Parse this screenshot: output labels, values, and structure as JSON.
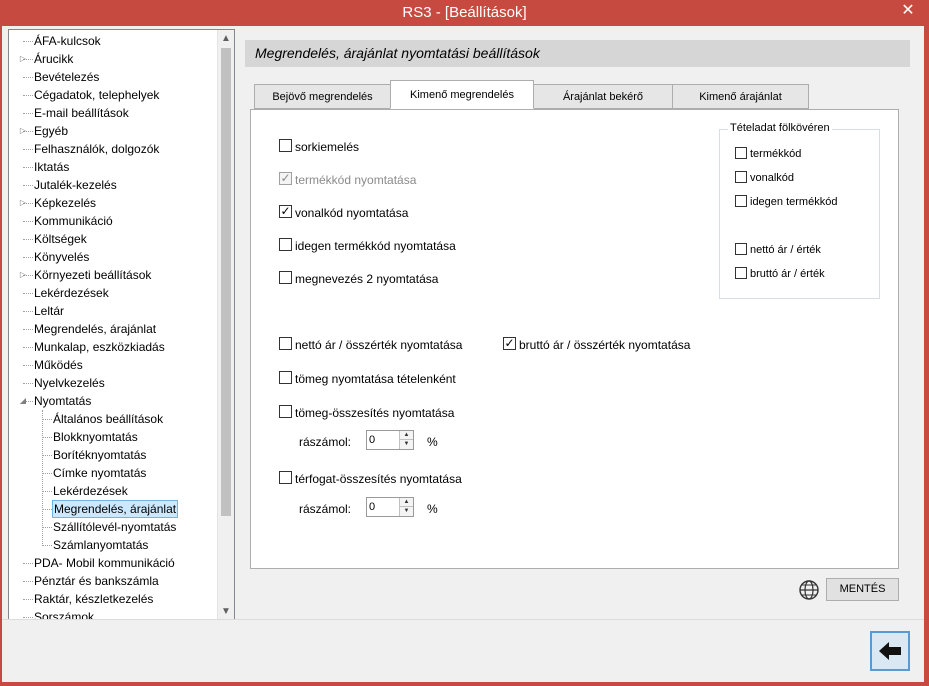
{
  "window": {
    "title": "RS3 - [Beállítások]",
    "close_label": "✕"
  },
  "tree": {
    "items": [
      {
        "label": "ÁFA-kulcsok",
        "level": 0,
        "expandable": false
      },
      {
        "label": "Árucikk",
        "level": 0,
        "expandable": true
      },
      {
        "label": "Bevételezés",
        "level": 0,
        "expandable": false
      },
      {
        "label": "Cégadatok, telephelyek",
        "level": 0,
        "expandable": false
      },
      {
        "label": "E-mail beállítások",
        "level": 0,
        "expandable": false
      },
      {
        "label": "Egyéb",
        "level": 0,
        "expandable": true
      },
      {
        "label": "Felhasználók, dolgozók",
        "level": 0,
        "expandable": false
      },
      {
        "label": "Iktatás",
        "level": 0,
        "expandable": false
      },
      {
        "label": "Jutalék-kezelés",
        "level": 0,
        "expandable": false
      },
      {
        "label": "Képkezelés",
        "level": 0,
        "expandable": true
      },
      {
        "label": "Kommunikáció",
        "level": 0,
        "expandable": false
      },
      {
        "label": "Költségek",
        "level": 0,
        "expandable": false
      },
      {
        "label": "Könyvelés",
        "level": 0,
        "expandable": false
      },
      {
        "label": "Környezeti beállítások",
        "level": 0,
        "expandable": true
      },
      {
        "label": "Lekérdezések",
        "level": 0,
        "expandable": false
      },
      {
        "label": "Leltár",
        "level": 0,
        "expandable": false
      },
      {
        "label": "Megrendelés, árajánlat",
        "level": 0,
        "expandable": false
      },
      {
        "label": "Munkalap, eszközkiadás",
        "level": 0,
        "expandable": false
      },
      {
        "label": "Működés",
        "level": 0,
        "expandable": false
      },
      {
        "label": "Nyelvkezelés",
        "level": 0,
        "expandable": false
      },
      {
        "label": "Nyomtatás",
        "level": 0,
        "expandable": true,
        "expanded": true
      },
      {
        "label": "Általános beállítások",
        "level": 1,
        "expandable": false
      },
      {
        "label": "Blokknyomtatás",
        "level": 1,
        "expandable": false
      },
      {
        "label": "Borítéknyomtatás",
        "level": 1,
        "expandable": false
      },
      {
        "label": "Címke nyomtatás",
        "level": 1,
        "expandable": false
      },
      {
        "label": "Lekérdezések",
        "level": 1,
        "expandable": false
      },
      {
        "label": "Megrendelés, árajánlat",
        "level": 1,
        "expandable": false,
        "selected": true
      },
      {
        "label": "Szállítólevél-nyomtatás",
        "level": 1,
        "expandable": false
      },
      {
        "label": "Számlanyomtatás",
        "level": 1,
        "expandable": false
      },
      {
        "label": "PDA- Mobil kommunikáció",
        "level": 0,
        "expandable": false
      },
      {
        "label": "Pénztár és bankszámla",
        "level": 0,
        "expandable": false
      },
      {
        "label": "Raktár, készletkezelés",
        "level": 0,
        "expandable": false
      },
      {
        "label": "Sorszámok",
        "level": 0,
        "expandable": false
      }
    ]
  },
  "section": {
    "title": "Megrendelés, árajánlat nyomtatási beállítások"
  },
  "tabs": [
    {
      "label": "Bejövő megrendelés",
      "active": false
    },
    {
      "label": "Kimenő megrendelés",
      "active": true
    },
    {
      "label": "Árajánlat bekérő",
      "active": false
    },
    {
      "label": "Kimenő árajánlat",
      "active": false
    }
  ],
  "options": {
    "sorkiemeles": {
      "label": "sorkiemelés",
      "checked": false,
      "disabled": false
    },
    "termekkod": {
      "label": "termékkód nyomtatása",
      "checked": true,
      "disabled": true
    },
    "vonalkod": {
      "label": "vonalkód nyomtatása",
      "checked": true,
      "disabled": false
    },
    "idegen": {
      "label": "idegen termékkód nyomtatása",
      "checked": false,
      "disabled": false
    },
    "megnevezes2": {
      "label": "megnevezés 2 nyomtatása",
      "checked": false,
      "disabled": false
    },
    "netto": {
      "label": "nettó ár / összérték nyomtatása",
      "checked": false,
      "disabled": false
    },
    "brutto": {
      "label": "bruttó ár / összérték nyomtatása",
      "checked": true,
      "disabled": false
    },
    "tomeg_tetel": {
      "label": "tömeg nyomtatása tételenként",
      "checked": false,
      "disabled": false
    },
    "tomeg_ossz": {
      "label": "tömeg-összesítés nyomtatása",
      "checked": false,
      "disabled": false
    },
    "terfogat_ossz": {
      "label": "térfogat-összesítés nyomtatása",
      "checked": false,
      "disabled": false
    }
  },
  "group": {
    "title": "Tételadat fölkövéren",
    "items": {
      "termekkod": {
        "label": "termékkód",
        "checked": false
      },
      "vonalkod": {
        "label": "vonalkód",
        "checked": false
      },
      "idegen": {
        "label": "idegen termékkód",
        "checked": false
      },
      "netto": {
        "label": "nettó ár / érték",
        "checked": false
      },
      "brutto": {
        "label": "bruttó ár / érték",
        "checked": false
      }
    }
  },
  "spinners": {
    "tomeg": {
      "label": "rászámol:",
      "value": "0",
      "unit": "%"
    },
    "terfogat": {
      "label": "rászámol:",
      "value": "0",
      "unit": "%"
    }
  },
  "footer": {
    "save_label": "MENTÉS",
    "globe_icon": "globe-icon",
    "back_icon": "arrow-left-icon"
  },
  "colors": {
    "titlebar": "#c74a41",
    "selection": "#cce8ff",
    "header": "#d6d6d6"
  }
}
